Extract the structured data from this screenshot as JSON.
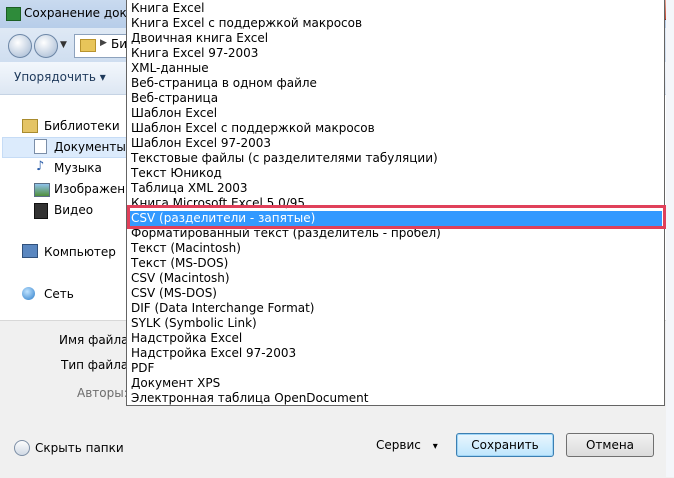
{
  "window": {
    "title": "Сохранение докум"
  },
  "address": {
    "path": "Биб"
  },
  "toolbar": {
    "organize_label": "Упорядочить",
    "organize_arrow": "▾"
  },
  "nav": {
    "items": [
      {
        "label": "Библиотеки",
        "icon": "library-icon"
      },
      {
        "label": "Документы",
        "icon": "documents-icon"
      },
      {
        "label": "Музыка",
        "icon": "music-icon"
      },
      {
        "label": "Изображения",
        "icon": "pictures-icon"
      },
      {
        "label": "Видео",
        "icon": "video-icon"
      },
      {
        "label": "Компьютер",
        "icon": "computer-icon"
      },
      {
        "label": "Сеть",
        "icon": "network-icon"
      }
    ]
  },
  "form": {
    "filename_label": "Имя файла:",
    "filetype_label": "Тип файла:",
    "authors_label": "Авторы:"
  },
  "footer": {
    "hide_folders_label": "Скрыть папки",
    "tools_label": "Сервис",
    "tools_arrow": "▾",
    "save_label": "Сохранить",
    "cancel_label": "Отмена"
  },
  "dropdown": {
    "selected_index": 14,
    "highlight_color": "#e0405a",
    "selected_color": "#3399ff",
    "options": [
      "Книга Excel",
      "Книга Excel с поддержкой макросов",
      "Двоичная книга Excel",
      "Книга Excel 97-2003",
      "XML-данные",
      "Веб-страница в одном файле",
      "Веб-страница",
      "Шаблон Excel",
      "Шаблон Excel с поддержкой макросов",
      "Шаблон Excel 97-2003",
      "Текстовые файлы (с разделителями табуляции)",
      "Текст Юникод",
      "Таблица XML 2003",
      "Книга Microsoft Excel 5.0/95",
      "CSV (разделители - запятые)",
      "Форматированный текст (разделитель - пробел)",
      "Текст (Macintosh)",
      "Текст (MS-DOS)",
      "CSV (Macintosh)",
      "CSV (MS-DOS)",
      "DIF (Data Interchange Format)",
      "SYLK (Symbolic Link)",
      "Надстройка Excel",
      "Надстройка Excel 97-2003",
      "PDF",
      "Документ XPS",
      "Электронная таблица OpenDocument"
    ]
  }
}
